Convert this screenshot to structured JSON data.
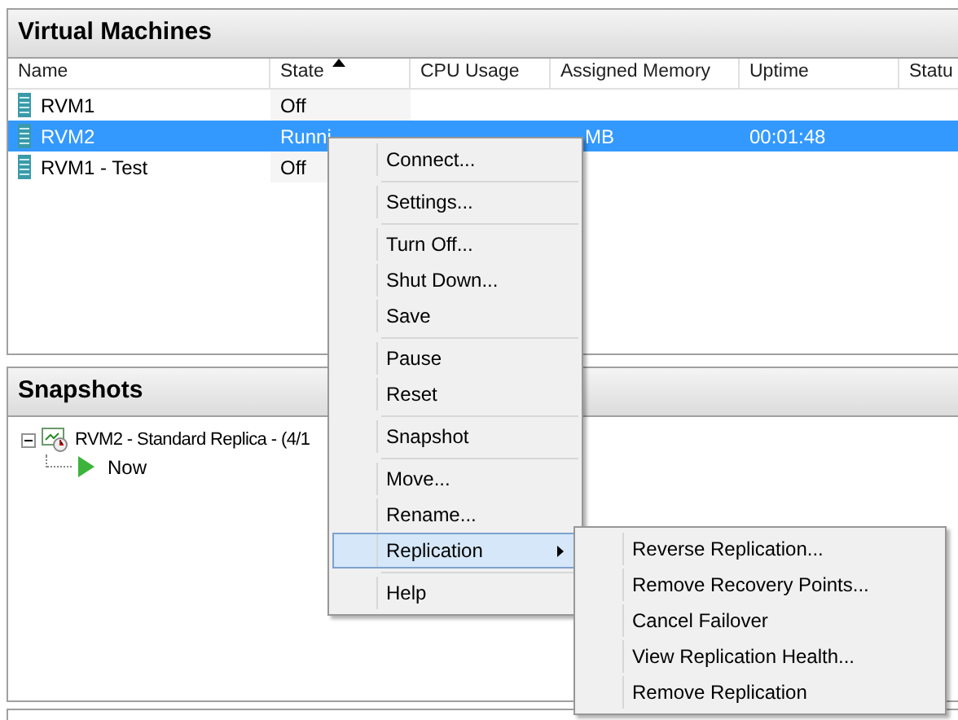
{
  "vm_panel": {
    "title": "Virtual Machines",
    "columns": [
      {
        "label": "Name",
        "sorted": false
      },
      {
        "label": "State",
        "sorted": true
      },
      {
        "label": "CPU Usage",
        "sorted": false
      },
      {
        "label": "Assigned Memory",
        "sorted": false
      },
      {
        "label": "Uptime",
        "sorted": false
      },
      {
        "label": "Statu",
        "sorted": false
      }
    ],
    "rows": [
      {
        "name": "RVM1",
        "state": "Off",
        "cpu": "",
        "memory": "",
        "uptime": "",
        "selected": false
      },
      {
        "name": "RVM2",
        "state": "Runni",
        "cpu": "",
        "memory": "MB",
        "uptime": "00:01:48",
        "selected": true
      },
      {
        "name": "RVM1 - Test",
        "state": "Off",
        "cpu": "",
        "memory": "",
        "uptime": "",
        "selected": false
      }
    ]
  },
  "snapshots_panel": {
    "title": "Snapshots",
    "tree": [
      {
        "label": "RVM2 - Standard Replica - (4/1",
        "expanded": true,
        "children": [
          {
            "label": "Now"
          }
        ]
      }
    ]
  },
  "context_menu": {
    "items": [
      {
        "kind": "item",
        "label": "Connect..."
      },
      {
        "kind": "separator"
      },
      {
        "kind": "item",
        "label": "Settings..."
      },
      {
        "kind": "separator"
      },
      {
        "kind": "item",
        "label": "Turn Off..."
      },
      {
        "kind": "item",
        "label": "Shut Down..."
      },
      {
        "kind": "item",
        "label": "Save"
      },
      {
        "kind": "separator"
      },
      {
        "kind": "item",
        "label": "Pause"
      },
      {
        "kind": "item",
        "label": "Reset"
      },
      {
        "kind": "separator"
      },
      {
        "kind": "item",
        "label": "Snapshot"
      },
      {
        "kind": "separator"
      },
      {
        "kind": "item",
        "label": "Move..."
      },
      {
        "kind": "item",
        "label": "Rename..."
      },
      {
        "kind": "submenu",
        "label": "Replication",
        "selected": true
      },
      {
        "kind": "separator"
      },
      {
        "kind": "item",
        "label": "Help"
      }
    ],
    "submenu": {
      "items": [
        {
          "kind": "item",
          "label": "Reverse Replication..."
        },
        {
          "kind": "item",
          "label": "Remove Recovery Points..."
        },
        {
          "kind": "item",
          "label": "Cancel Failover"
        },
        {
          "kind": "item",
          "label": "View Replication Health..."
        },
        {
          "kind": "item",
          "label": "Remove Replication"
        }
      ]
    }
  }
}
